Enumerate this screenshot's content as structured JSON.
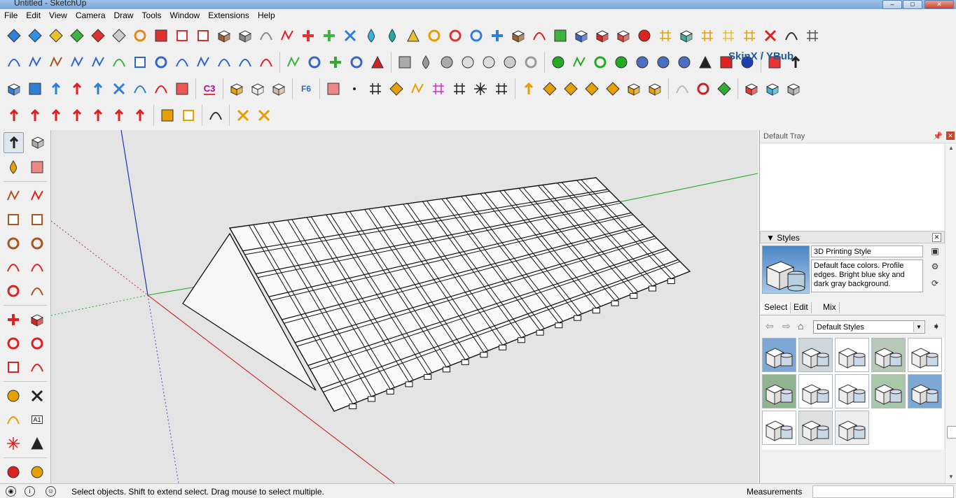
{
  "window": {
    "title": "Untitled - SketchUp"
  },
  "menu": [
    "File",
    "Edit",
    "View",
    "Camera",
    "Draw",
    "Tools",
    "Window",
    "Extensions",
    "Help"
  ],
  "toolbar": {
    "ext_label": "SkinX / YBub",
    "c3_label": "C3",
    "f6_label": "F6"
  },
  "lefttools": {
    "text_tool_label": "A1"
  },
  "tray": {
    "title": "Default Tray",
    "styles_panel": {
      "heading": "Styles",
      "style_name": "3D Printing Style",
      "style_description": "Default face colors. Profile edges. Bright blue sky and dark gray background.",
      "tabs": [
        "Select",
        "Edit",
        "Mix"
      ],
      "collection": "Default Styles"
    }
  },
  "status": {
    "message": "Select objects. Shift to extend select. Drag mouse to select multiple.",
    "measurements_label": "Measurements"
  }
}
